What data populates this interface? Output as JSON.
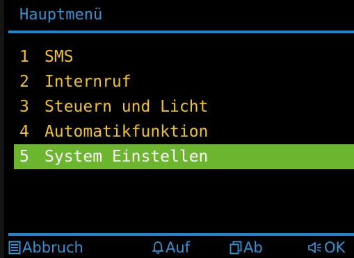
{
  "header": {
    "title": "Hauptmenü"
  },
  "menu": {
    "selected_index": 4,
    "items": [
      {
        "number": "1",
        "label": "SMS"
      },
      {
        "number": "2",
        "label": "Internruf"
      },
      {
        "number": "3",
        "label": "Steuern und Licht"
      },
      {
        "number": "4",
        "label": "Automatikfunktion"
      },
      {
        "number": "5",
        "label": "System Einstellen"
      }
    ]
  },
  "footer": {
    "cancel": {
      "label": "Abbruch",
      "icon": "list-icon"
    },
    "up": {
      "label": "Auf",
      "icon": "bell-icon"
    },
    "down": {
      "label": "Ab",
      "icon": "copy-icon"
    },
    "ok": {
      "label": "OK",
      "icon": "speaker-icon"
    }
  },
  "colors": {
    "background": "#000000",
    "accent_blue": "#1f86cf",
    "menu_text": "#f0c419",
    "selection": "#6cb62f",
    "selected_text": "#ffffff"
  }
}
